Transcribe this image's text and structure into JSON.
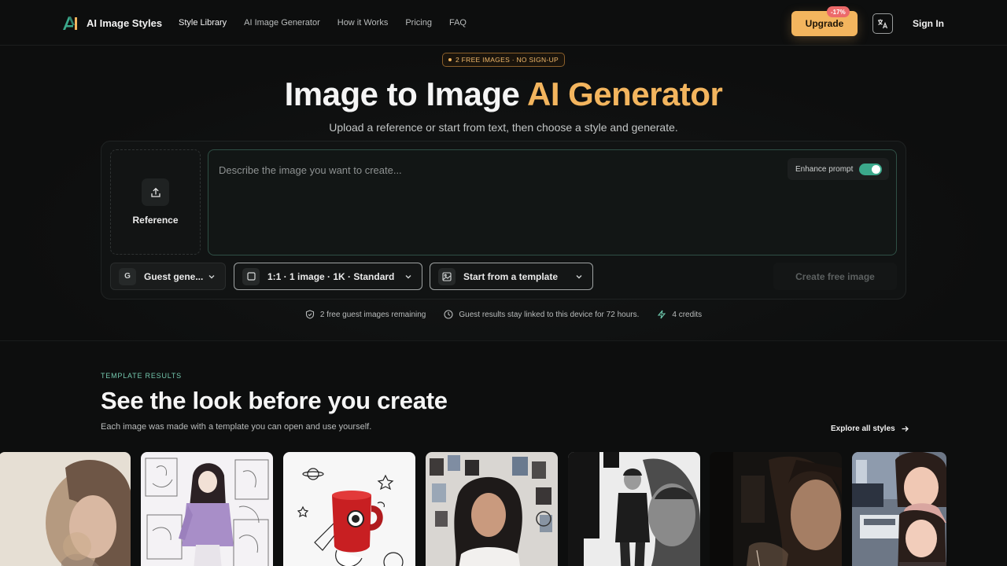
{
  "brand": {
    "name": "AI Image Styles"
  },
  "nav": {
    "links": [
      "Style Library",
      "AI Image Generator",
      "How it Works",
      "Pricing",
      "FAQ"
    ],
    "upgrade_label": "Upgrade",
    "discount": "-17%",
    "signin_label": "Sign In"
  },
  "hero": {
    "promo": "2 FREE IMAGES · NO SIGN-UP",
    "title_main": "Image to Image ",
    "title_accent": "AI Generator",
    "subtitle": "Upload a reference or start from text, then choose a style and generate."
  },
  "composer": {
    "reference_label": "Reference",
    "prompt_placeholder": "Describe the image you want to create...",
    "enhance_label": "Enhance prompt",
    "enhance_on": true,
    "model_badge": "G",
    "model_label": "Guest gene...",
    "size_label": "1:1 · 1 image · 1K · Standard",
    "template_label": "Start from a template",
    "create_label": "Create free image"
  },
  "info": {
    "free_remaining": "2 free guest images remaining",
    "retention": "Guest results stay linked to this device for 72 hours.",
    "credits": "4 credits"
  },
  "templates": {
    "kicker": "TEMPLATE RESULTS",
    "title": "See the look before you create",
    "subtitle": "Each image was made with a template you can open and use yourself.",
    "explore_label": "Explore all styles",
    "cards": [
      "watercolor-portrait",
      "anime-sketch-sheet",
      "rocket-mug-doodle",
      "photo-wall-portrait",
      "bw-poster-portrait",
      "dark-moody-selfie",
      "city-night-collage"
    ]
  },
  "colors": {
    "accent": "#f3b55e",
    "teal": "#3ba88b",
    "background": "#0d0e0e"
  }
}
